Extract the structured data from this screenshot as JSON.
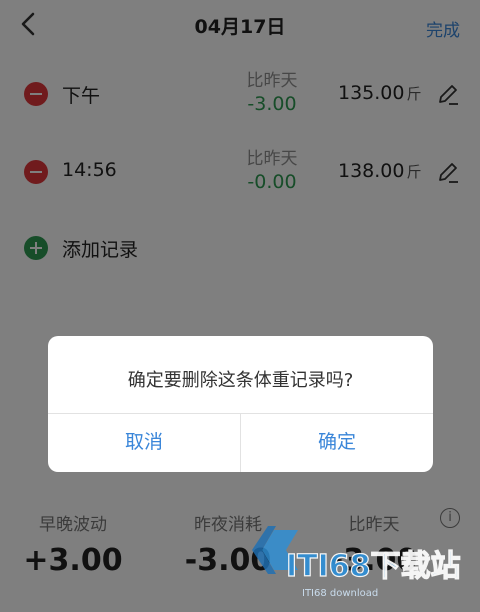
{
  "header": {
    "title": "04月17日",
    "done_label": "完成"
  },
  "records": [
    {
      "label": "下午",
      "compare_label": "比昨天",
      "compare_value": "-3.00",
      "weight": "135.00",
      "unit": "斤"
    },
    {
      "label": "14:56",
      "compare_label": "比昨天",
      "compare_value": "-0.00",
      "weight": "138.00",
      "unit": "斤"
    }
  ],
  "add_record": {
    "label": "添加记录"
  },
  "stats": [
    {
      "label": "早晚波动",
      "value": "+3.00"
    },
    {
      "label": "昨夜消耗",
      "value": "-3.00"
    },
    {
      "label": "比昨天",
      "value": "-3.00"
    }
  ],
  "dialog": {
    "message": "确定要删除这条体重记录吗?",
    "cancel_label": "取消",
    "confirm_label": "确定"
  },
  "watermark": {
    "text": "ITI68下载站"
  },
  "colors": {
    "accent": "#3a86d9",
    "positive": "#2f9a52",
    "danger": "#e0373a",
    "overlay": "rgba(0,0,0,0.5)"
  }
}
